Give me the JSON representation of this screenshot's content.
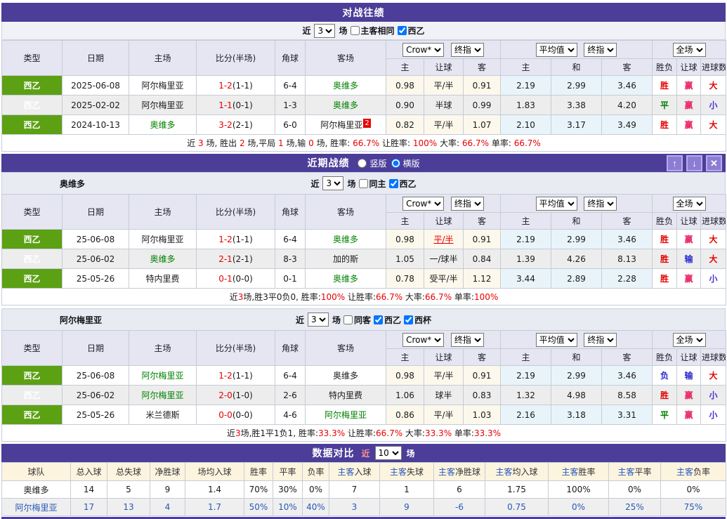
{
  "labels": {
    "recent": "近",
    "games": "场"
  },
  "cols": {
    "type": "类型",
    "date": "日期",
    "home": "主场",
    "score": "比分(半场)",
    "corner": "角球",
    "away": "客场",
    "oddsHome": "主",
    "oddsHandicap": "让球",
    "oddsAway": "客",
    "avgHome": "主",
    "avgDraw": "和",
    "avgAway": "客",
    "resWL": "胜负",
    "resHandicap": "让球",
    "resGoals": "进球数"
  },
  "selects": {
    "provider": "Crow*",
    "stage": "终指",
    "avg": "平均值",
    "stage2": "终指",
    "scope": "全场"
  },
  "h2h": {
    "title": "对战往绩",
    "filter": {
      "count": "3",
      "sameVenue": "主客相同",
      "sameVenueChecked": false,
      "league": "西乙",
      "leagueChecked": true
    },
    "rows": [
      {
        "type": "西乙",
        "date": "2025-06-08",
        "home": {
          "t": "阿尔梅里亚"
        },
        "score": {
          "ft": "1-2",
          "ht": "(1-1)"
        },
        "corner": "6-4",
        "away": {
          "t": "奥维多",
          "c": "g"
        },
        "odds": [
          {
            "t": "0.98"
          },
          {
            "t": "平/半"
          },
          {
            "t": "0.91"
          }
        ],
        "avg": [
          "2.19",
          "2.99",
          "3.46"
        ],
        "res": [
          {
            "t": "胜",
            "c": "r"
          },
          {
            "t": "赢",
            "c": "w"
          },
          {
            "t": "大",
            "c": "r"
          }
        ]
      },
      {
        "type": "西乙",
        "date": "2025-02-02",
        "home": {
          "t": "阿尔梅里亚"
        },
        "score": {
          "ft": "1-1",
          "ht": "(0-1)"
        },
        "corner": "1-3",
        "away": {
          "t": "奥维多",
          "c": "g"
        },
        "odds": [
          {
            "t": "0.90"
          },
          {
            "t": "半球"
          },
          {
            "t": "0.99"
          }
        ],
        "avg": [
          "1.83",
          "3.38",
          "4.20"
        ],
        "res": [
          {
            "t": "平",
            "c": "g"
          },
          {
            "t": "赢",
            "c": "w"
          },
          {
            "t": "小",
            "c": "v"
          }
        ]
      },
      {
        "type": "西乙",
        "date": "2024-10-13",
        "home": {
          "t": "奥维多",
          "c": "g"
        },
        "score": {
          "ft": "3-2",
          "ht": "(2-1)"
        },
        "corner": "6-0",
        "away": {
          "t": "阿尔梅里亚",
          "badge": "2"
        },
        "odds": [
          {
            "t": "0.82"
          },
          {
            "t": "平/半"
          },
          {
            "t": "1.07"
          }
        ],
        "avg": [
          "2.10",
          "3.17",
          "3.49"
        ],
        "res": [
          {
            "t": "胜",
            "c": "r"
          },
          {
            "t": "赢",
            "c": "w"
          },
          {
            "t": "大",
            "c": "r"
          }
        ]
      }
    ],
    "summary": [
      {
        "t": "近 "
      },
      {
        "t": "3",
        "c": "r"
      },
      {
        "t": " 场, 胜出 "
      },
      {
        "t": "2",
        "c": "r"
      },
      {
        "t": " 场,平局 "
      },
      {
        "t": "1",
        "c": "r"
      },
      {
        "t": " 场,输 "
      },
      {
        "t": "0",
        "c": "r"
      },
      {
        "t": " 场, 胜率: "
      },
      {
        "t": "66.7%",
        "c": "r"
      },
      {
        "t": " 让胜率: "
      },
      {
        "t": "100%",
        "c": "r"
      },
      {
        "t": " 大率: "
      },
      {
        "t": "66.7%",
        "c": "r"
      },
      {
        "t": " 单率: "
      },
      {
        "t": "66.7%",
        "c": "r"
      }
    ]
  },
  "recent": {
    "title": "近期战绩",
    "verticalLabel": "竖版",
    "verticalChecked": false,
    "horizontalLabel": "横版",
    "horizontalChecked": true,
    "buttons": {
      "up": "↑",
      "down": "↓",
      "close": "✕"
    },
    "teams": [
      {
        "name": "奥维多",
        "filter": {
          "count": "3",
          "same": "同主",
          "sameChecked": false,
          "leagues": [
            {
              "label": "西乙",
              "checked": true
            }
          ]
        },
        "rows": [
          {
            "type": "西乙",
            "date": "25-06-08",
            "home": {
              "t": "阿尔梅里亚"
            },
            "score": {
              "ft": "1-2",
              "ht": "(1-1)"
            },
            "corner": "6-4",
            "away": {
              "t": "奥维多",
              "c": "g"
            },
            "odds": [
              {
                "t": "0.98"
              },
              {
                "t": "平/半",
                "c": "ru"
              },
              {
                "t": "0.91"
              }
            ],
            "avg": [
              "2.19",
              "2.99",
              "3.46"
            ],
            "res": [
              {
                "t": "胜",
                "c": "r"
              },
              {
                "t": "赢",
                "c": "w"
              },
              {
                "t": "大",
                "c": "r"
              }
            ]
          },
          {
            "type": "西乙",
            "date": "25-06-02",
            "home": {
              "t": "奥维多",
              "c": "g"
            },
            "score": {
              "ft": "2-1",
              "ht": "(2-1)"
            },
            "corner": "8-3",
            "away": {
              "t": "加的斯"
            },
            "odds": [
              {
                "t": "1.05"
              },
              {
                "t": "一/球半"
              },
              {
                "t": "0.84"
              }
            ],
            "avg": [
              "1.39",
              "4.26",
              "8.13"
            ],
            "res": [
              {
                "t": "胜",
                "c": "r"
              },
              {
                "t": "输",
                "c": "b"
              },
              {
                "t": "大",
                "c": "r"
              }
            ]
          },
          {
            "type": "西乙",
            "date": "25-05-26",
            "home": {
              "t": "特内里费"
            },
            "score": {
              "ft": "0-1",
              "ht": "(0-0)"
            },
            "corner": "0-1",
            "away": {
              "t": "奥维多",
              "c": "g"
            },
            "odds": [
              {
                "t": "0.78"
              },
              {
                "t": "受平/半"
              },
              {
                "t": "1.12"
              }
            ],
            "avg": [
              "3.44",
              "2.89",
              "2.28"
            ],
            "res": [
              {
                "t": "胜",
                "c": "r"
              },
              {
                "t": "赢",
                "c": "w"
              },
              {
                "t": "小",
                "c": "v"
              }
            ]
          }
        ],
        "summary": [
          {
            "t": "近"
          },
          {
            "t": "3",
            "c": "r"
          },
          {
            "t": "场,胜3平0负0, 胜率:"
          },
          {
            "t": "100%",
            "c": "r"
          },
          {
            "t": " 让胜率:"
          },
          {
            "t": "66.7%",
            "c": "r"
          },
          {
            "t": " 大率:"
          },
          {
            "t": "66.7%",
            "c": "r"
          },
          {
            "t": " 单率:"
          },
          {
            "t": "100%",
            "c": "r"
          }
        ]
      },
      {
        "name": "阿尔梅里亚",
        "filter": {
          "count": "3",
          "same": "同客",
          "sameChecked": false,
          "leagues": [
            {
              "label": "西乙",
              "checked": true
            },
            {
              "label": "西杯",
              "checked": true
            }
          ]
        },
        "rows": [
          {
            "type": "西乙",
            "date": "25-06-08",
            "home": {
              "t": "阿尔梅里亚",
              "c": "g"
            },
            "score": {
              "ft": "1-2",
              "ht": "(1-1)"
            },
            "corner": "6-4",
            "away": {
              "t": "奥维多"
            },
            "odds": [
              {
                "t": "0.98"
              },
              {
                "t": "平/半"
              },
              {
                "t": "0.91"
              }
            ],
            "avg": [
              "2.19",
              "2.99",
              "3.46"
            ],
            "res": [
              {
                "t": "负",
                "c": "b"
              },
              {
                "t": "输",
                "c": "b"
              },
              {
                "t": "大",
                "c": "r"
              }
            ]
          },
          {
            "type": "西乙",
            "date": "25-06-02",
            "home": {
              "t": "阿尔梅里亚",
              "c": "g"
            },
            "score": {
              "ft": "2-0",
              "ht": "(1-0)"
            },
            "corner": "2-6",
            "away": {
              "t": "特内里费"
            },
            "odds": [
              {
                "t": "1.06"
              },
              {
                "t": "球半"
              },
              {
                "t": "0.83"
              }
            ],
            "avg": [
              "1.32",
              "4.98",
              "8.58"
            ],
            "res": [
              {
                "t": "胜",
                "c": "r"
              },
              {
                "t": "赢",
                "c": "w"
              },
              {
                "t": "小",
                "c": "v"
              }
            ]
          },
          {
            "type": "西乙",
            "date": "25-05-26",
            "home": {
              "t": "米兰德斯"
            },
            "score": {
              "ft": "0-0",
              "ht": "(0-0)"
            },
            "corner": "4-6",
            "away": {
              "t": "阿尔梅里亚",
              "c": "g"
            },
            "odds": [
              {
                "t": "0.86"
              },
              {
                "t": "平/半"
              },
              {
                "t": "1.03"
              }
            ],
            "avg": [
              "2.16",
              "3.18",
              "3.31"
            ],
            "res": [
              {
                "t": "平",
                "c": "g"
              },
              {
                "t": "赢",
                "c": "w"
              },
              {
                "t": "小",
                "c": "v"
              }
            ]
          }
        ],
        "summary": [
          {
            "t": "近"
          },
          {
            "t": "3",
            "c": "r"
          },
          {
            "t": "场,胜1平1负1, 胜率:"
          },
          {
            "t": "33.3%",
            "c": "r"
          },
          {
            "t": " 让胜率:"
          },
          {
            "t": "66.7%",
            "c": "r"
          },
          {
            "t": " 大率:"
          },
          {
            "t": "33.3%",
            "c": "r"
          },
          {
            "t": " 单率:"
          },
          {
            "t": "33.3%",
            "c": "r"
          }
        ]
      }
    ]
  },
  "compare": {
    "title": "数据对比",
    "count": "10",
    "headers": [
      "球队",
      "总入球",
      "总失球",
      "净胜球",
      "场均入球",
      "胜率",
      "平率",
      "负率",
      "主客入球",
      "主客失球",
      "主客净胜球",
      "主客均入球",
      "主客胜率",
      "主客平率",
      "主客负率"
    ],
    "rows": [
      {
        "team": "奥维多",
        "link": false,
        "values": [
          "14",
          "5",
          "9",
          "1.4",
          "70%",
          "30%",
          "0%",
          "7",
          "1",
          "6",
          "1.75",
          "100%",
          "0%",
          "0%"
        ]
      },
      {
        "team": "阿尔梅里亚",
        "link": true,
        "values": [
          "17",
          "13",
          "4",
          "1.7",
          "50%",
          "10%",
          "40%",
          "3",
          "9",
          "-6",
          "0.75",
          "0%",
          "25%",
          "75%"
        ]
      }
    ]
  },
  "colors": {
    "accent_purple": "#4c3d99",
    "league_green": "#5ca014",
    "win_red": "#e60000",
    "lose_blue": "#2a2ad0",
    "team_green": "#008000",
    "link_blue": "#2a58b8"
  }
}
